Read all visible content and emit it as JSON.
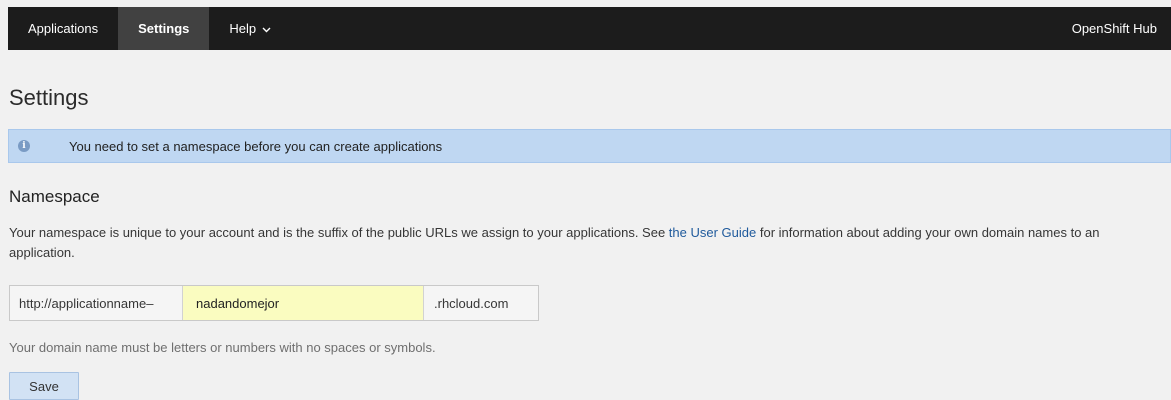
{
  "nav": {
    "items": [
      {
        "label": "Applications",
        "active": false
      },
      {
        "label": "Settings",
        "active": true
      },
      {
        "label": "Help",
        "active": false,
        "has_dropdown": true
      }
    ],
    "right_label": "OpenShift Hub"
  },
  "page": {
    "title": "Settings"
  },
  "alert": {
    "icon": "info-icon",
    "message": "You need to set a namespace before you can create applications",
    "color": "#bfd7f2"
  },
  "namespace": {
    "heading": "Namespace",
    "desc_before": "Your namespace is unique to your account and is the suffix of the public URLs we assign to your applications. See ",
    "desc_link": "the User Guide",
    "desc_after": " for information about adding your own domain names to an application.",
    "prefix": "http://applicationname–",
    "value": "nadandomejor",
    "suffix": ".rhcloud.com",
    "help": "Your domain name must be letters or numbers with no spaces or symbols.",
    "save_label": "Save"
  },
  "colors": {
    "navbar": "#1c1c1c",
    "active_tab": "#414141",
    "input_highlight": "#fafcc0",
    "link": "#1f5a9c"
  }
}
